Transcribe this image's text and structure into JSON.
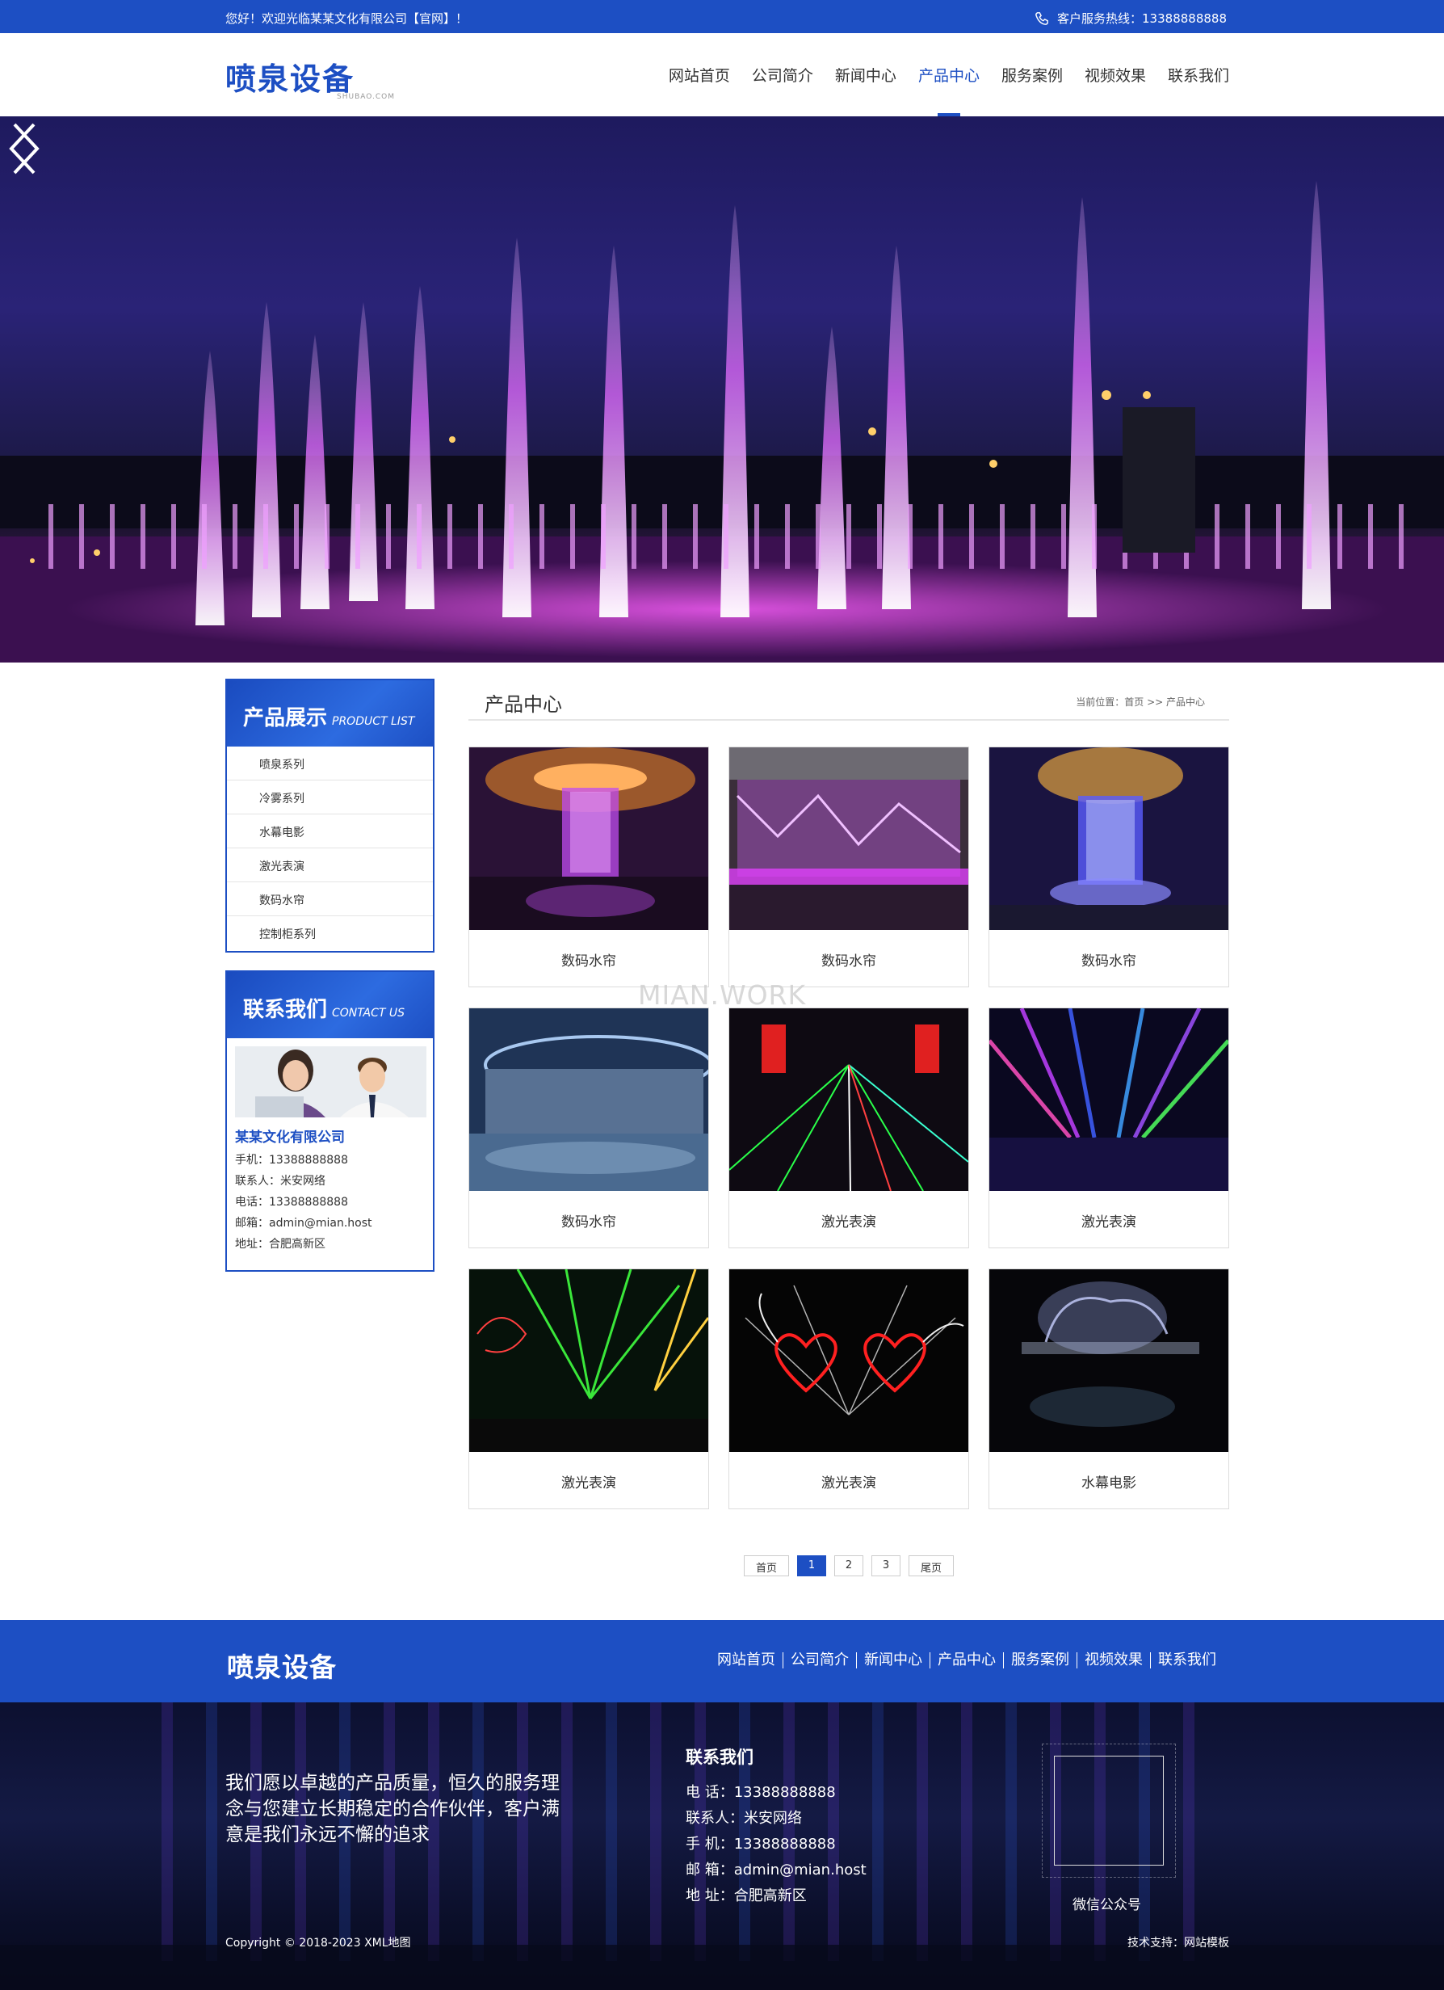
{
  "topbar": {
    "welcome": "您好！欢迎光临某某文化有限公司【官网】！",
    "hotline_label": "客户服务热线：13388888888"
  },
  "header": {
    "logo_text": "喷泉设备",
    "logo_sub": "SHUBAO.COM",
    "nav": [
      "网站首页",
      "公司简介",
      "新闻中心",
      "产品中心",
      "服务案例",
      "视频效果",
      "联系我们"
    ],
    "active_nav": "产品中心"
  },
  "sidebar": {
    "product_list": {
      "title_cn": "产品展示",
      "title_en": "PRODUCT LIST",
      "items": [
        "喷泉系列",
        "冷雾系列",
        "水幕电影",
        "激光表演",
        "数码水帘",
        "控制柜系列"
      ]
    },
    "contact": {
      "title_cn": "联系我们",
      "title_en": "CONTACT US",
      "company": "某某文化有限公司",
      "lines": [
        "手机：13388888888",
        "联系人：米安网络",
        "电话：13388888888",
        "邮箱：admin@mian.host",
        "地址：合肥高新区"
      ]
    }
  },
  "main": {
    "title": "产品中心",
    "breadcrumb": "当前位置：首页 >> 产品中心",
    "products": [
      {
        "name": "数码水帘",
        "icon": "water-curtain-lobby-image"
      },
      {
        "name": "数码水帘",
        "icon": "water-curtain-wall-image"
      },
      {
        "name": "数码水帘",
        "icon": "water-curtain-cylinder-image"
      },
      {
        "name": "数码水帘",
        "icon": "water-curtain-pool-image"
      },
      {
        "name": "激光表演",
        "icon": "laser-show-stage-image"
      },
      {
        "name": "激光表演",
        "icon": "laser-show-beams-image"
      },
      {
        "name": "激光表演",
        "icon": "laser-show-green-image"
      },
      {
        "name": "激光表演",
        "icon": "laser-show-hearts-image"
      },
      {
        "name": "水幕电影",
        "icon": "water-screen-movie-image"
      }
    ],
    "watermark": "MIAN.WORK",
    "pagination": [
      "首页",
      "1",
      "2",
      "3",
      "尾页"
    ],
    "current_page": "1"
  },
  "footer": {
    "logo_text": "喷泉设备",
    "nav": [
      "网站首页",
      "公司简介",
      "新闻中心",
      "产品中心",
      "服务案例",
      "视频效果",
      "联系我们"
    ],
    "slogan": "我们愿以卓越的产品质量，恒久的服务理念与您建立长期稳定的合作伙伴，客户满意是我们永远不懈的追求",
    "contact_title": "联系我们",
    "contact_lines": [
      "电 话：13388888888",
      "联系人：米安网络",
      "手 机：13388888888",
      "邮 箱：admin@mian.host",
      "地 址：合肥高新区"
    ],
    "qr_label": "微信公众号",
    "copyright": "Copyright © 2018-2023 XML地图",
    "tech": "技术支持：网站模板"
  },
  "colors": {
    "brand_blue": "#1d4fc3",
    "fountain_magenta": "#e040fb"
  }
}
